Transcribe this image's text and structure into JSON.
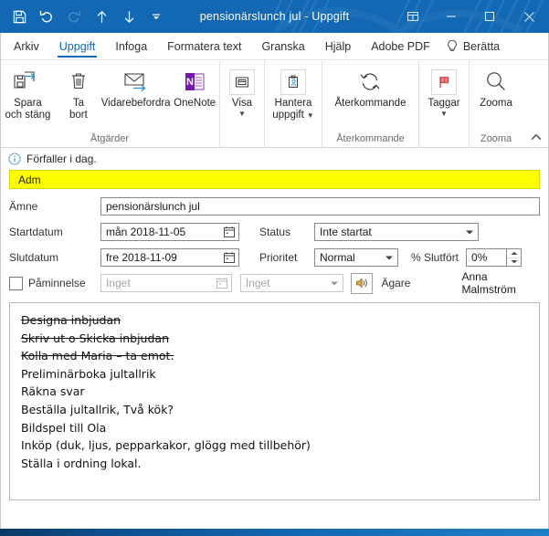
{
  "window": {
    "title": "pensionärslunch jul  -  Uppgift",
    "titlebar_color": "#1268b3",
    "quick_access": [
      {
        "name": "save-icon",
        "label": "Spara"
      },
      {
        "name": "undo-icon",
        "label": "Ångra"
      },
      {
        "name": "redo-icon",
        "label": "Gör om"
      },
      {
        "name": "previous-item-icon",
        "label": "Föregående objekt"
      },
      {
        "name": "next-item-icon",
        "label": "Nästa objekt"
      },
      {
        "name": "customize-quick-access-icon",
        "label": "Anpassa verktygsfältet Snabbåtkomst"
      }
    ],
    "controls": [
      {
        "name": "ribbon-display-options-icon",
        "label": "Alternativ för menyfliksområdet"
      },
      {
        "name": "minimize-icon",
        "label": "Minimera"
      },
      {
        "name": "maximize-icon",
        "label": "Maximera"
      },
      {
        "name": "close-icon",
        "label": "Stäng"
      }
    ]
  },
  "tabs": [
    {
      "label": "Arkiv",
      "active": false
    },
    {
      "label": "Uppgift",
      "active": true
    },
    {
      "label": "Infoga",
      "active": false
    },
    {
      "label": "Formatera text",
      "active": false
    },
    {
      "label": "Granska",
      "active": false
    },
    {
      "label": "Hjälp",
      "active": false
    },
    {
      "label": "Adobe PDF",
      "active": false
    }
  ],
  "tell_me": {
    "label": "Berätta",
    "icon": "lightbulb-icon"
  },
  "ribbon": {
    "groups": [
      {
        "label": "Åtgärder",
        "buttons": [
          {
            "line1": "Spara",
            "line2": "och stäng",
            "icon": "save-and-close-icon",
            "caret": false
          },
          {
            "line1": "Ta",
            "line2": "bort",
            "icon": "delete-icon",
            "caret": false
          },
          {
            "line1": "Vidarebefordra",
            "line2": "",
            "icon": "forward-icon",
            "caret": false
          },
          {
            "line1": "OneNote",
            "line2": "",
            "icon": "onenote-icon",
            "caret": false
          }
        ]
      },
      {
        "label": "",
        "buttons": [
          {
            "line1": "Visa",
            "line2": "",
            "icon": "show-icon",
            "caret": true
          }
        ]
      },
      {
        "label": "",
        "buttons": [
          {
            "line1": "Hantera",
            "line2": "uppgift",
            "icon": "manage-task-icon",
            "caret": true
          }
        ]
      },
      {
        "label": "Återkommande",
        "buttons": [
          {
            "line1": "Återkommande",
            "line2": "",
            "icon": "recurrence-icon",
            "caret": false
          }
        ]
      },
      {
        "label": "",
        "buttons": [
          {
            "line1": "Taggar",
            "line2": "",
            "icon": "flag-icon",
            "caret": true
          }
        ]
      },
      {
        "label": "Zooma",
        "buttons": [
          {
            "line1": "Zooma",
            "line2": "",
            "icon": "zoom-icon",
            "caret": false
          }
        ]
      }
    ],
    "collapse_icon": "chevron-up-icon"
  },
  "info_bar": {
    "icon": "info-icon",
    "text": "Förfaller i dag."
  },
  "category": {
    "label": "Adm",
    "color": "#ffff00"
  },
  "fields": {
    "subject": {
      "label": "Ämne",
      "value": "pensionärslunch jul",
      "placeholder": ""
    },
    "start_date": {
      "label": "Startdatum",
      "value": "mån 2018-11-05",
      "icon": "calendar-icon"
    },
    "status": {
      "label": "Status",
      "value": "Inte startat",
      "icon": "chevron-down-icon"
    },
    "due_date": {
      "label": "Slutdatum",
      "value": "fre 2018-11-09",
      "icon": "calendar-icon"
    },
    "priority": {
      "label": "Prioritet",
      "value": "Normal",
      "icon": "chevron-down-icon"
    },
    "percent_complete": {
      "label": "% Slutfört",
      "value": "0%",
      "icon": "spinner-icon"
    },
    "reminder": {
      "label": "Påminnelse",
      "checked": false
    },
    "reminder_date": {
      "value": "Inget",
      "icon": "calendar-icon"
    },
    "reminder_time": {
      "value": "Inget",
      "icon": "chevron-down-icon"
    },
    "reminder_sound": {
      "icon": "sound-icon"
    },
    "owner": {
      "label": "Ägare",
      "value": "Anna Malmström"
    }
  },
  "notes": {
    "lines": [
      {
        "text": "Designa inbjudan",
        "struck": true
      },
      {
        "text": "Skriv ut o Skicka inbjudan",
        "struck": true
      },
      {
        "text": "Kolla med Maria – ta emot.",
        "struck": true
      },
      {
        "text": "Preliminärboka jultallrik",
        "struck": false
      },
      {
        "text": "Räkna svar",
        "struck": false
      },
      {
        "text": "Beställa jultallrik, Två kök?",
        "struck": false
      },
      {
        "text": "Bildspel till Ola",
        "struck": false
      },
      {
        "text": "Inköp (duk, ljus, pepparkakor, glögg med tillbehör)",
        "struck": false
      },
      {
        "text": "Ställa i ordning lokal.",
        "struck": false
      }
    ]
  }
}
